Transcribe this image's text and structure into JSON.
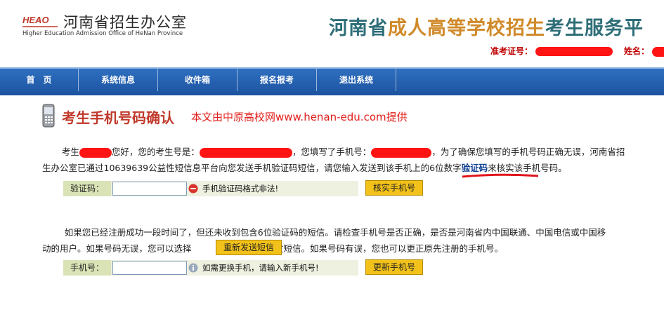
{
  "header": {
    "logo_text": "HEAO",
    "org_cn": "河南省招生办公室",
    "org_en": "Higher Education Admission Office of HeNan Province",
    "banner_part1": "河南省",
    "banner_part2": "成人高等学校招生",
    "banner_part3": "考生服务平",
    "exam_no_label": "准考证号：",
    "name_label": "姓名："
  },
  "nav": {
    "items": [
      "首　页",
      "系统信息",
      "收件箱",
      "报名报考",
      "退出系统"
    ]
  },
  "page": {
    "title": "考生手机号码确认",
    "source": "本文由中原高校网www.henan-edu.com提供"
  },
  "para1": {
    "t1": "考生",
    "t2": "您好，您的考生号是：",
    "t3": "，您填写了手机号：",
    "t4": "，为了确保您填写的手机号码正确无误，河南省招",
    "t5": "生办公室已通过10639639公益性短信息平台向您发送手机验证码短信，请您输入发送到该手机上的6位数字",
    "link": "验证码",
    "t6": "来核实该手机号码。"
  },
  "form1": {
    "label": "验证码：",
    "value": "",
    "message": "手机验证码格式非法!",
    "button": "核实手机号",
    "status_color": "#d9342b"
  },
  "para2": {
    "line1": "如果您已经注册成功一段时间了，但还未收到包含6位验证码的短信。请检查手机号是否正确，是否是河南省内中国联通、中国电信或中国移",
    "t1": "动的用户。如果号码无误，您可以选择",
    "resend_button": "重新发送短信",
    "t2": "重发短信。如果号码有误，您也可以更正原先注册的手机号。"
  },
  "form2": {
    "label": "手机号：",
    "value": "",
    "message": "如需更换手机，请输入新手机号!",
    "button": "更新手机号"
  },
  "icons": {
    "error": "error-icon",
    "info": "info-icon",
    "phone": "mobile-phone-icon"
  }
}
